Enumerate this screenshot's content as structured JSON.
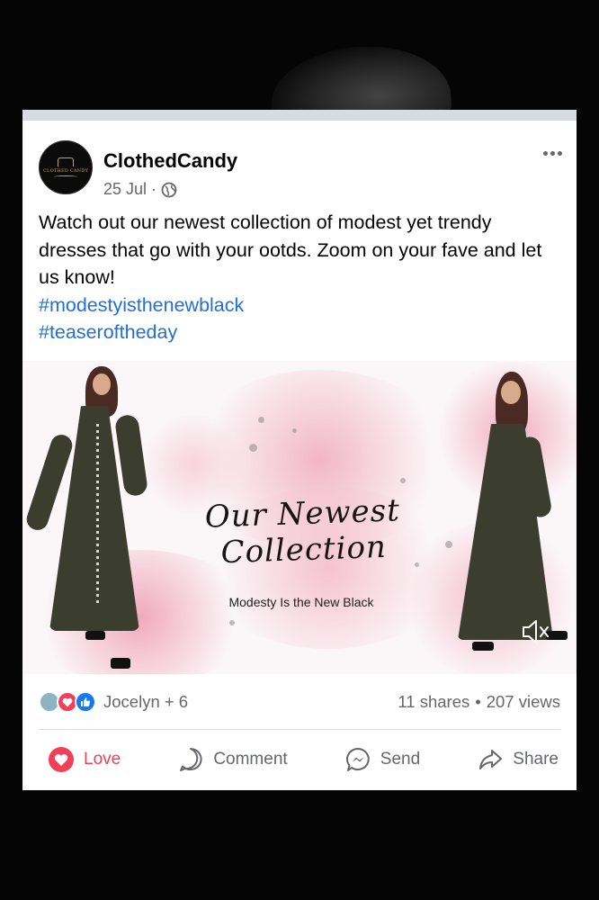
{
  "post": {
    "page_name": "ClothedCandy",
    "avatar_text": "CLOTHED CANDY",
    "date": "25 Jul",
    "audience_icon": "globe-icon",
    "more_icon": "more-horizontal-icon",
    "text": "Watch out our newest collection of modest yet trendy dresses that go with your ootds. Zoom on your fave and let us know!",
    "hashtags": [
      "#modestyisthenewblack",
      "#teaseroftheday"
    ]
  },
  "image": {
    "title": "Our Newest Collection",
    "subtitle": "Modesty Is the New Black",
    "mute_icon": "volume-muted-icon"
  },
  "engagement": {
    "reactors": "Jocelyn + 6",
    "shares": "11 shares",
    "separator": "•",
    "views": "207 views"
  },
  "actions": {
    "love": "Love",
    "comment": "Comment",
    "send": "Send",
    "share": "Share"
  },
  "colors": {
    "love": "#f33e58",
    "like": "#1877f2",
    "hashtag": "#216fdb",
    "meta": "#65676b"
  }
}
